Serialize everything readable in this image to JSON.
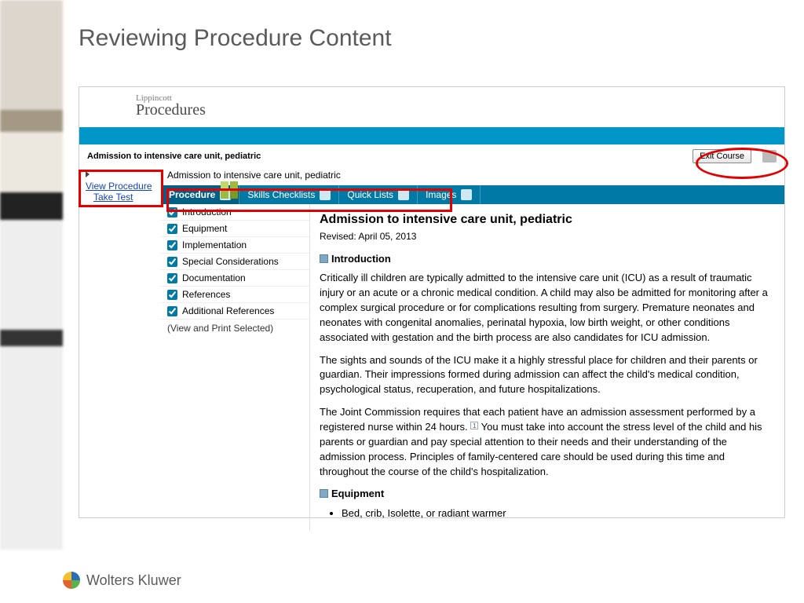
{
  "slide": {
    "title": "Reviewing Procedure Content"
  },
  "brand": {
    "top": "Lippincott",
    "main": "Procedures"
  },
  "header": {
    "subtitle": "Admission to intensive care unit, pediatric",
    "exit_label": "Exit Course"
  },
  "leftRail": {
    "view": "View Procedure",
    "take": "Take Test"
  },
  "content": {
    "heading": "Admission to intensive care unit, pediatric"
  },
  "tabs": [
    {
      "label": "Procedure",
      "icon": "refresh-icon"
    },
    {
      "label": "Skills Checklists",
      "icon": "check-icon"
    },
    {
      "label": "Quick Lists",
      "icon": "list-icon"
    },
    {
      "label": "Images",
      "icon": "image-icon"
    }
  ],
  "toc": {
    "items": [
      "Introduction",
      "Equipment",
      "Implementation",
      "Special Considerations",
      "Documentation",
      "References",
      "Additional References"
    ],
    "footer": "(View and Print Selected)"
  },
  "article": {
    "title": "Admission to intensive care unit, pediatric",
    "revised": "Revised: April 05, 2013",
    "sections": {
      "intro_h": "Introduction",
      "p1": "Critically ill children are typically admitted to the intensive care unit (ICU) as a result of traumatic injury or an acute or a chronic medical condition. A child may also be admitted for monitoring after a complex surgical procedure or for complications resulting from surgery. Premature neonates and neonates with congenital anomalies, perinatal hypoxia, low birth weight, or other conditions associated with gestation and the birth process are also candidates for ICU admission.",
      "p2": "The sights and sounds of the ICU make it a highly stressful place for children and their parents or guardian. Their impressions formed during admission can affect the child's medical condition, psychological status, recuperation, and future hospitalizations.",
      "p3a": "The Joint Commission requires that each patient have an admission assessment performed by a registered nurse within 24 hours. ",
      "p3b": "You must take into account the stress level of the child and his parents or guardian and pay special attention to their needs and their understanding of the admission process. Principles of family-centered care should be used during this time and throughout the course of the child's hospitalization.",
      "equip_h": "Equipment",
      "equip_item": "Bed, crib, Isolette, or radiant warmer"
    }
  },
  "footer": {
    "company": "Wolters Kluwer"
  }
}
